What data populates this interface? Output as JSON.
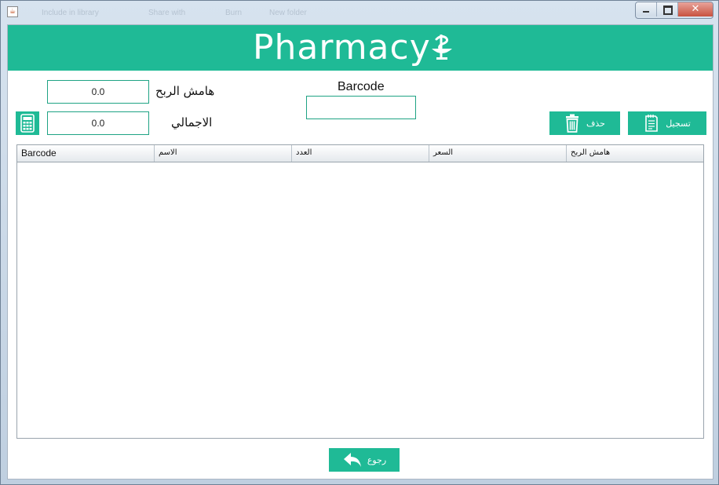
{
  "titlebar": {
    "menu_ghost": [
      "Include in library",
      "Share with",
      "Burn",
      "New folder"
    ],
    "minimize_label": "",
    "maximize_label": "",
    "close_label": "✕"
  },
  "header": {
    "brand": "Pharmacy"
  },
  "profit_margin": {
    "label": "هامش الربح",
    "value": "0.0"
  },
  "total": {
    "label": "الاجمالي",
    "value": "0.0"
  },
  "barcode_input": {
    "label": "Barcode",
    "value": ""
  },
  "buttons": {
    "delete": "حذف",
    "register": "تسجيل",
    "back": "رجوع"
  },
  "table": {
    "columns": [
      "Barcode",
      "الاسم",
      "العدد",
      "السعر",
      "هامش الربح"
    ],
    "rows": []
  },
  "colors": {
    "accent": "#1fba96"
  }
}
